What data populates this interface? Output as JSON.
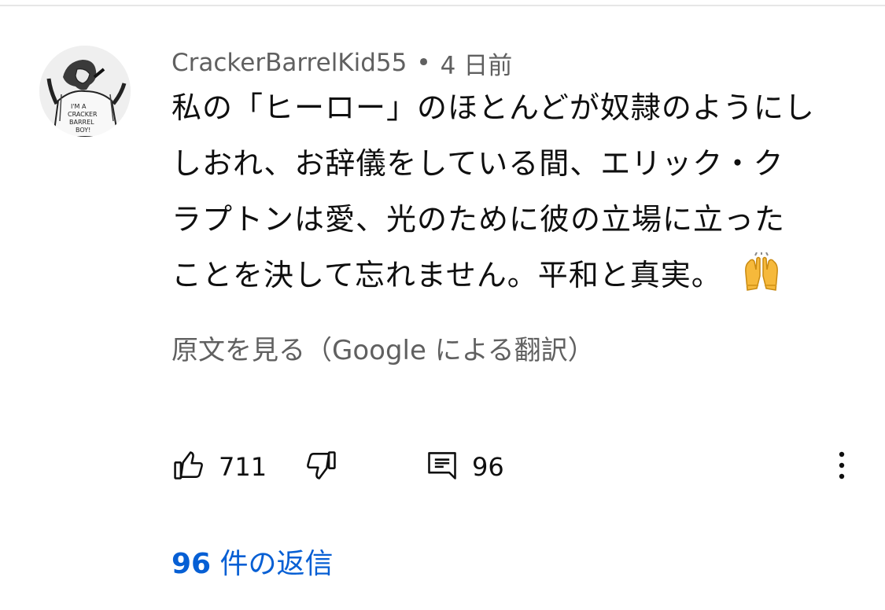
{
  "comment": {
    "author": "CrackerBarrelKid55",
    "separator": "•",
    "time": "4 日前",
    "body_lines": [
      "私の「ヒーロー」のほとんどが奴隷のようにし",
      "しおれ、お辞儀をしている間、エリック・ク",
      "ラプトンは愛、光のために彼の立場に立った",
      "ことを決して忘れません。平和と真実。"
    ],
    "emoji": "raising-hands-emoji",
    "translate_link": "原文を見る（Google による翻訳）"
  },
  "actions": {
    "like_count": "711",
    "reply_count": "96"
  },
  "replies": {
    "count": "96",
    "label": " 件の返信"
  },
  "colors": {
    "link": "#065fd4",
    "secondary_text": "#606060",
    "primary_text": "#0f0f0f"
  }
}
